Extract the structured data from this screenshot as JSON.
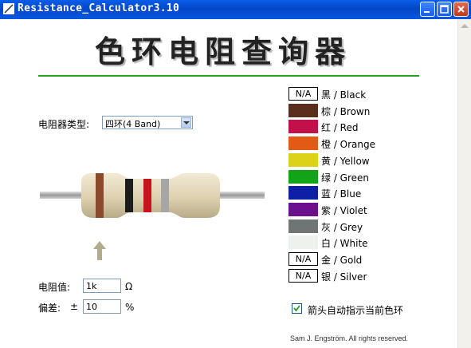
{
  "window": {
    "title": "Resistance_Calculator3.10"
  },
  "heading": "色环电阻查询器",
  "type_label": "电阻器类型:",
  "type_select": {
    "value": "四环(4 Band)"
  },
  "resistance": {
    "label": "电阻值:",
    "value": "1k",
    "unit": "Ω"
  },
  "tolerance": {
    "label": "偏差:",
    "prefix": "±",
    "value": "10",
    "unit": "%"
  },
  "resistor_bands": [
    {
      "color": "Brown",
      "hex": "#8b4a2b"
    },
    {
      "color": "Black",
      "hex": "#1c1c1c"
    },
    {
      "color": "Red",
      "hex": "#c8131c"
    },
    {
      "color": "Silver",
      "hex": "#a6a6a6"
    }
  ],
  "legend": [
    {
      "label": "黑 / Black",
      "swatch": "N/A",
      "hex": ""
    },
    {
      "label": "棕 / Brown",
      "swatch": "",
      "hex": "#5a2e1a"
    },
    {
      "label": "红 / Red",
      "swatch": "",
      "hex": "#c2104a"
    },
    {
      "label": "橙 / Orange",
      "swatch": "",
      "hex": "#e35a16"
    },
    {
      "label": "黄 / Yellow",
      "swatch": "",
      "hex": "#dcd318"
    },
    {
      "label": "绿 / Green",
      "swatch": "",
      "hex": "#12a318"
    },
    {
      "label": "蓝 / Blue",
      "swatch": "",
      "hex": "#0d1fa7"
    },
    {
      "label": "紫 / Violet",
      "swatch": "",
      "hex": "#6b0f8f"
    },
    {
      "label": "灰 / Grey",
      "swatch": "",
      "hex": "#6f7574"
    },
    {
      "label": "白 / White",
      "swatch": "",
      "hex": "#eef2ef"
    },
    {
      "label": "金 / Gold",
      "swatch": "N/A",
      "hex": ""
    },
    {
      "label": "银 / Silver",
      "swatch": "N/A",
      "hex": ""
    }
  ],
  "checkbox": {
    "label": "箭头自动指示当前色环",
    "checked": true
  },
  "credit": "Sam J. Engström. All rights reserved."
}
